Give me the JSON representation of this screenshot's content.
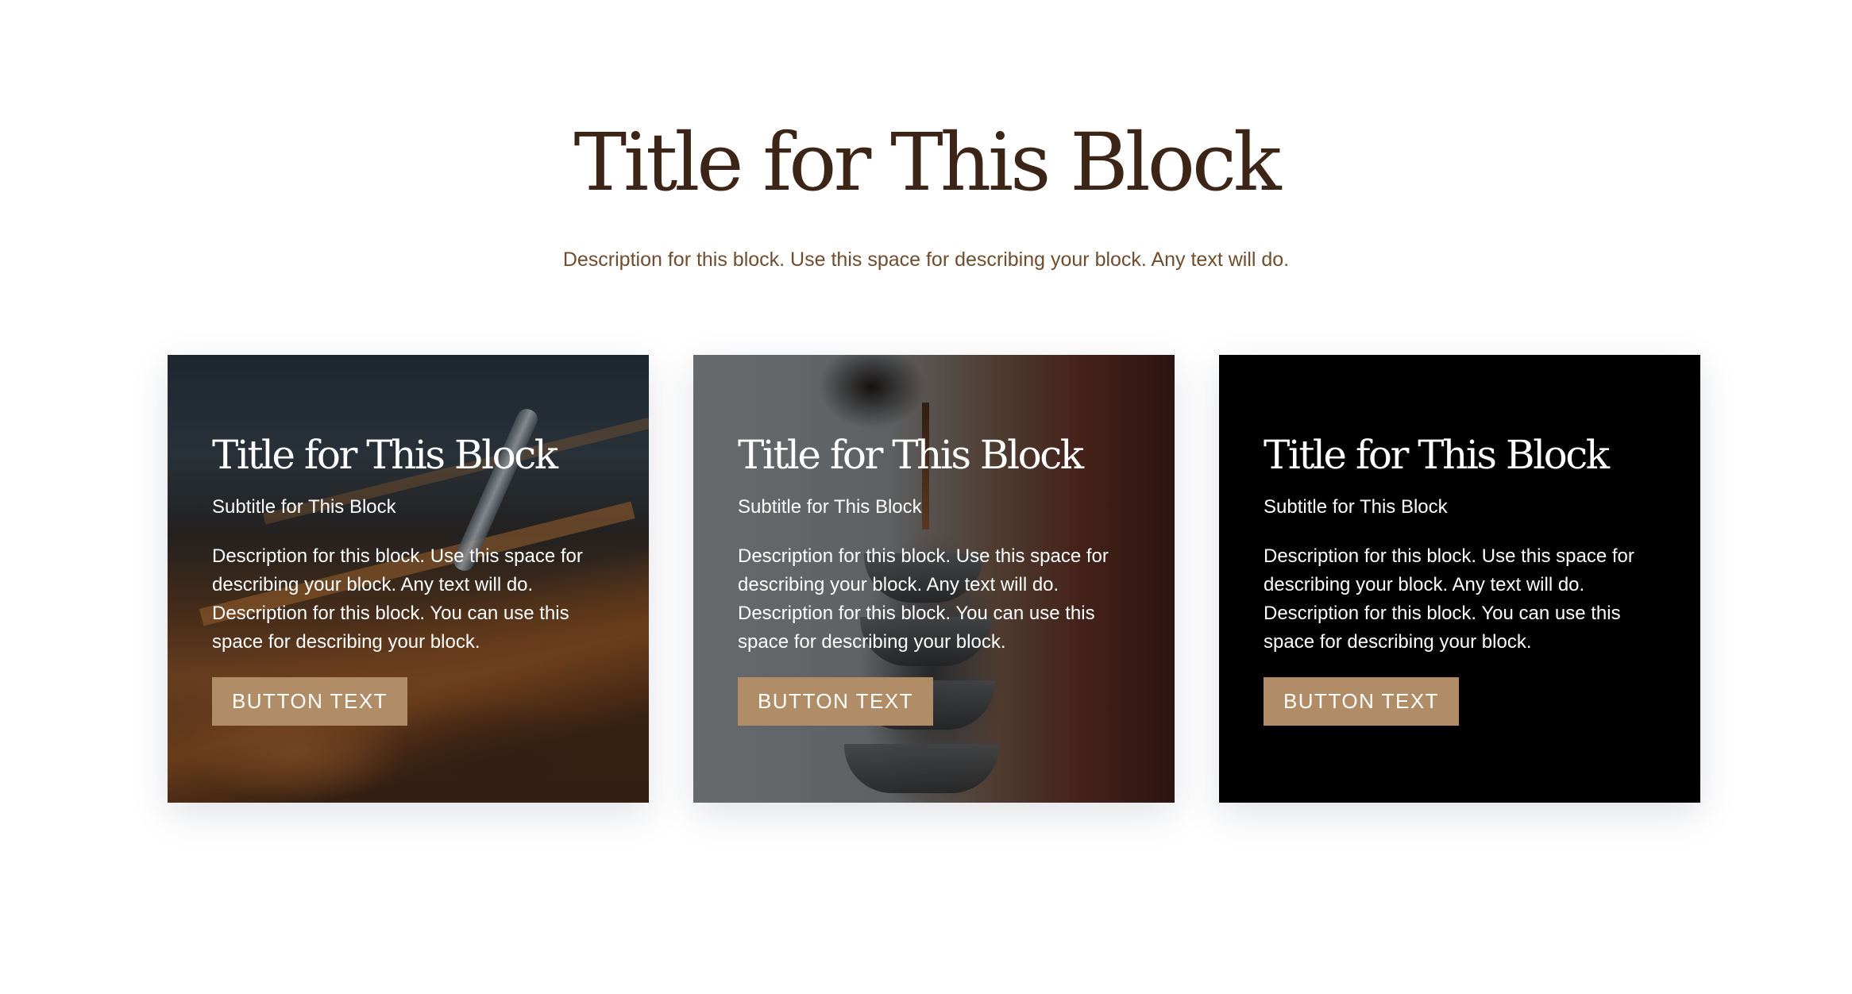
{
  "section": {
    "title": "Title for This Block",
    "description": "Description for this block. Use this space for describing your block. Any text will do."
  },
  "cards": [
    {
      "background": "photo-coffee-bean-bins",
      "title": "Title for This Block",
      "subtitle": "Subtitle for This Block",
      "description": "Description for this block. Use this space for describing your block. Any text will do. Description for this block. You can use this space for describing your block.",
      "button_label": "BUTTON TEXT"
    },
    {
      "background": "photo-coffee-pouring-cups",
      "title": "Title for This Block",
      "subtitle": "Subtitle for This Block",
      "description": "Description for this block. Use this space for describing your block. Any text will do. Description for this block. You can use this space for describing your block.",
      "button_label": "BUTTON TEXT"
    },
    {
      "background": "solid-black",
      "title": "Title for This Block",
      "subtitle": "Subtitle for This Block",
      "description": "Description for this block. Use this space for describing your block. Any text will do. Description for this block. You can use this space for describing your block.",
      "button_label": "BUTTON TEXT"
    }
  ],
  "colors": {
    "heading": "#3c2417",
    "section_description": "#6f4d2e",
    "button_background": "#b08d66",
    "card_text": "#ffffff",
    "black_card_background": "#000000",
    "page_background": "#ffffff"
  }
}
